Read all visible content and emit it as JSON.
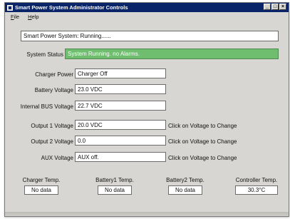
{
  "window": {
    "title": "Smart Power System Administrator Controls",
    "buttons": {
      "minimize": "_",
      "maximize": "□",
      "close": "×"
    }
  },
  "menu": {
    "file": "File",
    "help": "Help"
  },
  "system_state": "Smart Power System: Running......",
  "status": {
    "label": "System Status",
    "value": "System Running. no Alarms.",
    "color": "#6fbd6f"
  },
  "fields": {
    "charger_power": {
      "label": "Charger Power",
      "value": "Charger Off"
    },
    "battery_voltage": {
      "label": "Battery Voltage",
      "value": "23.0 VDC"
    },
    "internal_bus_voltage": {
      "label": "Internal BUS Voltage",
      "value": "22.7 VDC"
    },
    "output1_voltage": {
      "label": "Output 1 Voltage",
      "value": "20.0 VDC",
      "hint": "Click on Voltage to Change"
    },
    "output2_voltage": {
      "label": "Output 2 Voltage",
      "value": "0.0",
      "hint": "Click on Voltage to Change"
    },
    "aux_voltage": {
      "label": "AUX Voltage",
      "value": "AUX off.",
      "hint": "Click on Voltage to Change"
    }
  },
  "temps": [
    {
      "label": "Charger Temp.",
      "value": "No data"
    },
    {
      "label": "Battery1 Temp.",
      "value": "No data"
    },
    {
      "label": "Battery2 Temp.",
      "value": "No data"
    },
    {
      "label": "Controller Temp.",
      "value": "30.3°C"
    }
  ]
}
